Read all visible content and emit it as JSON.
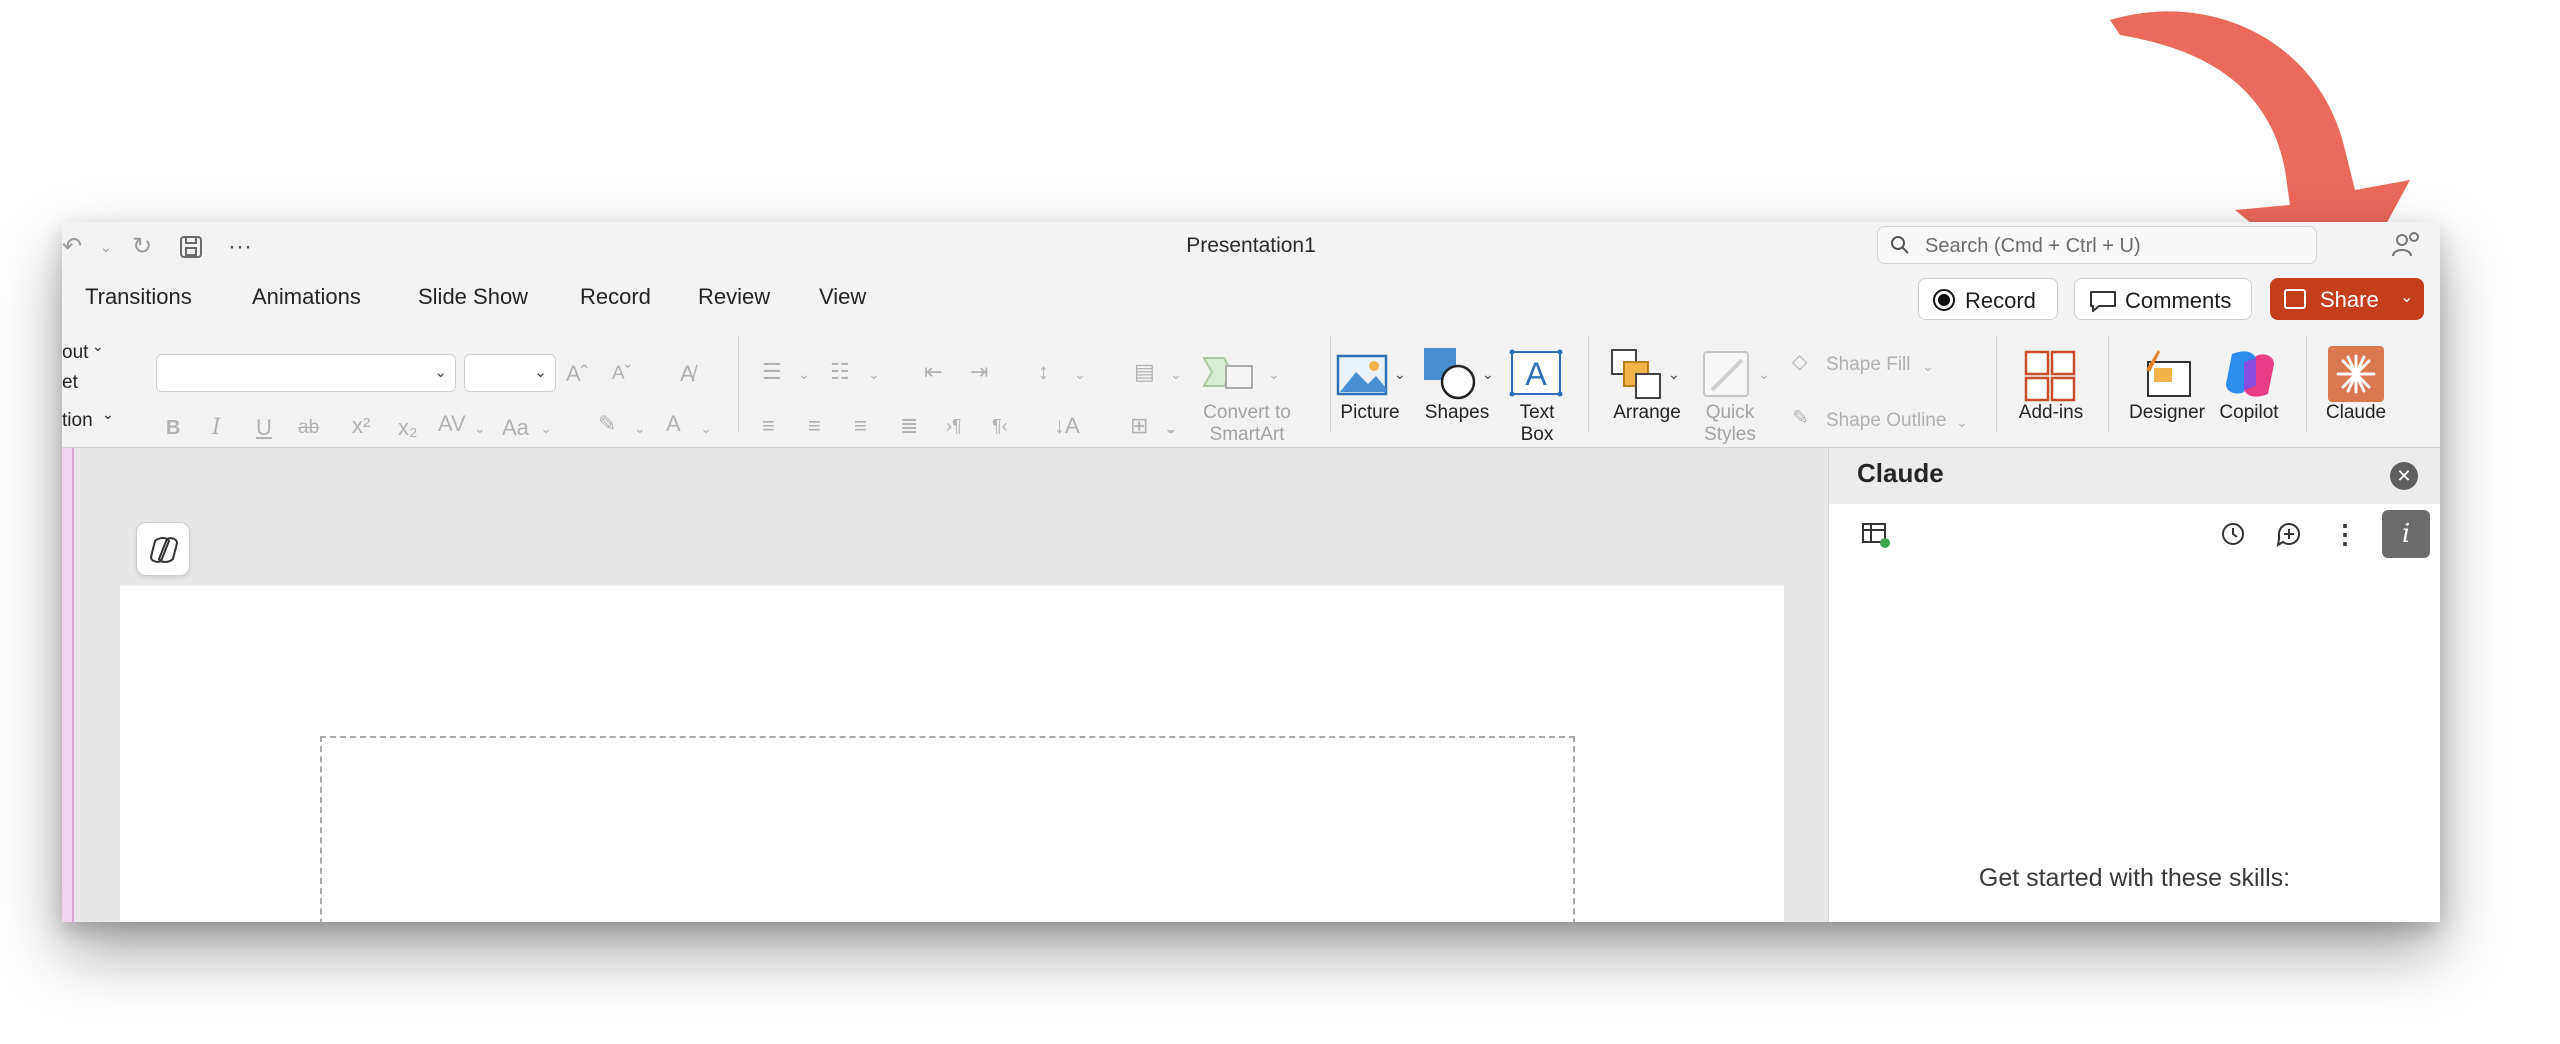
{
  "window": {
    "title": "Presentation1"
  },
  "search": {
    "placeholder": "Search (Cmd + Ctrl + U)"
  },
  "tabs": [
    "Transitions",
    "Animations",
    "Slide Show",
    "Record",
    "Review",
    "View"
  ],
  "header_buttons": {
    "record": "Record",
    "comments": "Comments",
    "share": "Share"
  },
  "ribbon": {
    "left_partial": [
      "out",
      "et",
      "tion"
    ],
    "convert_smartart": [
      "Convert to",
      "SmartArt"
    ],
    "picture": "Picture",
    "shapes": "Shapes",
    "text_box": [
      "Text",
      "Box"
    ],
    "arrange": "Arrange",
    "quick_styles": [
      "Quick",
      "Styles"
    ],
    "shape_fill": "Shape Fill",
    "shape_outline": "Shape Outline",
    "addins": "Add-ins",
    "designer": "Designer",
    "copilot": "Copilot",
    "claude": "Claude"
  },
  "pane": {
    "title": "Claude",
    "skills_heading": "Get started with these skills:"
  },
  "colors": {
    "share_bg": "#c43e1c",
    "arrow": "#ea6a5b",
    "claude_brand": "#d9774f"
  },
  "icons": [
    "undo-icon",
    "redo-icon",
    "save-icon",
    "more-icon",
    "search-icon",
    "people-icon",
    "comment-icon",
    "close-icon",
    "history-icon",
    "new-chat-icon",
    "kebab-icon",
    "info-icon",
    "sheet-icon"
  ]
}
